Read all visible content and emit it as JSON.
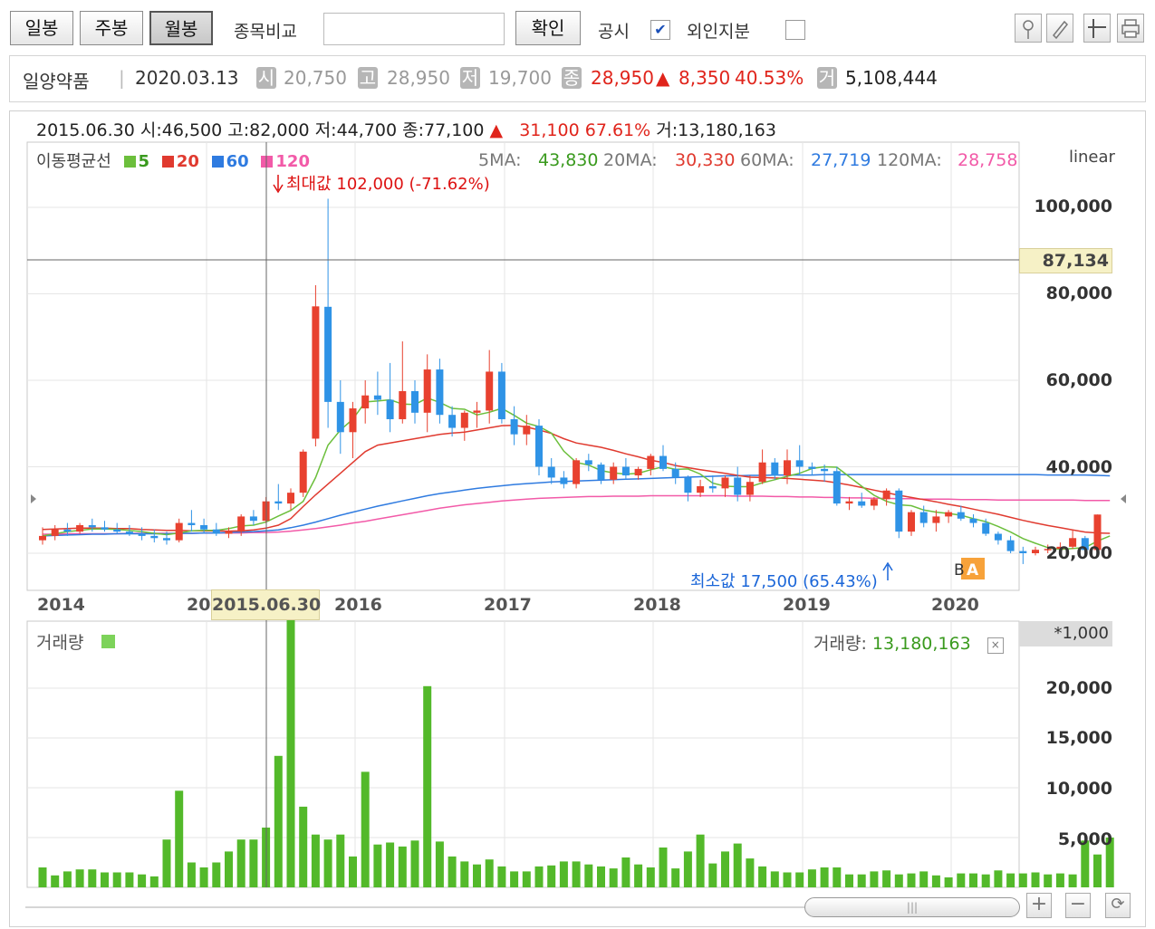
{
  "toolbar": {
    "tab_day": "일봉",
    "tab_week": "주봉",
    "tab_month": "월봉",
    "compare_label": "종목비교",
    "compare_value": "",
    "confirm": "확인",
    "disclosure_label": "공시",
    "disclosure_checked": "✔",
    "foreign_label": "외인지분"
  },
  "stock": {
    "name": "일양약품",
    "date": "2020.03.13",
    "open_badge": "시",
    "open": "20,750",
    "high_badge": "고",
    "high": "28,950",
    "low_badge": "저",
    "low": "19,700",
    "close_badge": "종",
    "close": "28,950",
    "change_arrow": "▲",
    "change": "8,350",
    "change_pct": "40.53%",
    "volume_badge": "거",
    "volume": "5,108,444"
  },
  "cursor": {
    "date": "2015.06.30",
    "open_label": "시:",
    "open": "46,500",
    "high_label": "고:",
    "high": "82,000",
    "low_label": "저:",
    "low": "44,700",
    "close_label": "종:",
    "close": "77,100",
    "arrow": "▲",
    "change": "31,100",
    "change_pct": "67.61%",
    "volume_label": "거:",
    "volume": "13,180,163",
    "price_marker": "87,134",
    "date_marker": "2015.06.30"
  },
  "ma": {
    "title": "이동평균선",
    "p5": "5",
    "p20": "20",
    "p60": "60",
    "p120": "120",
    "ma5_label": "5MA:",
    "ma5": "43,830",
    "ma20_label": "20MA:",
    "ma20": "30,330",
    "ma60_label": "60MA:",
    "ma60": "27,719",
    "ma120_label": "120MA:",
    "ma120": "28,758",
    "color5": "#6cbf3c",
    "color20": "#e03a2f",
    "color60": "#2f7be0",
    "color120": "#f25aa8"
  },
  "annotations": {
    "max_label": "최대값 102,000 (-71.62%)",
    "min_label": "최소값 17,500 (65.43%)",
    "scale": "linear",
    "marker_A": "A",
    "marker_B": "B"
  },
  "volume_panel": {
    "title": "거래량",
    "value_label": "거래량:",
    "value": "13,180,163",
    "unit": "*1,000"
  },
  "chart_data": {
    "type": "candlestick",
    "period": "monthly",
    "y_axis": {
      "min": 15000,
      "max": 110000,
      "ticks": [
        "100,000",
        "80,000",
        "60,000",
        "40,000",
        "20,000"
      ],
      "scale": "linear"
    },
    "x_axis": {
      "ticks": [
        "2014",
        "20",
        "2016",
        "2017",
        "2018",
        "2019",
        "2020"
      ]
    },
    "volume_axis": {
      "ticks": [
        "20,000",
        "15,000",
        "10,000",
        "5,000"
      ],
      "unit": "*1,000"
    },
    "candles": [
      {
        "o": 23000,
        "h": 26000,
        "l": 22000,
        "c": 24000
      },
      {
        "o": 24000,
        "h": 26500,
        "l": 23000,
        "c": 25500
      },
      {
        "o": 25500,
        "h": 27000,
        "l": 24000,
        "c": 25000
      },
      {
        "o": 25000,
        "h": 27000,
        "l": 24500,
        "c": 26500
      },
      {
        "o": 26500,
        "h": 28000,
        "l": 25000,
        "c": 26000
      },
      {
        "o": 26000,
        "h": 27500,
        "l": 25000,
        "c": 25500
      },
      {
        "o": 25500,
        "h": 27000,
        "l": 24500,
        "c": 25000
      },
      {
        "o": 25000,
        "h": 26500,
        "l": 24000,
        "c": 24500
      },
      {
        "o": 24500,
        "h": 26000,
        "l": 23000,
        "c": 24000
      },
      {
        "o": 24000,
        "h": 25500,
        "l": 22500,
        "c": 23500
      },
      {
        "o": 23500,
        "h": 25000,
        "l": 22000,
        "c": 23000
      },
      {
        "o": 23000,
        "h": 28000,
        "l": 22500,
        "c": 27000
      },
      {
        "o": 27000,
        "h": 30000,
        "l": 25000,
        "c": 26500
      },
      {
        "o": 26500,
        "h": 28000,
        "l": 24500,
        "c": 25500
      },
      {
        "o": 25500,
        "h": 27000,
        "l": 24000,
        "c": 24500
      },
      {
        "o": 24500,
        "h": 26000,
        "l": 23500,
        "c": 25000
      },
      {
        "o": 25000,
        "h": 29000,
        "l": 24000,
        "c": 28500
      },
      {
        "o": 28500,
        "h": 30000,
        "l": 26500,
        "c": 27500
      },
      {
        "o": 27500,
        "h": 33000,
        "l": 27000,
        "c": 32000
      },
      {
        "o": 32000,
        "h": 36000,
        "l": 30000,
        "c": 31500
      },
      {
        "o": 31500,
        "h": 35000,
        "l": 30000,
        "c": 34000
      },
      {
        "o": 34000,
        "h": 44000,
        "l": 33000,
        "c": 43500
      },
      {
        "o": 46500,
        "h": 82000,
        "l": 44700,
        "c": 77100
      },
      {
        "o": 77000,
        "h": 102000,
        "l": 49000,
        "c": 55000
      },
      {
        "o": 55000,
        "h": 60000,
        "l": 43000,
        "c": 48000
      },
      {
        "o": 48000,
        "h": 55000,
        "l": 42000,
        "c": 53500
      },
      {
        "o": 53500,
        "h": 60000,
        "l": 50000,
        "c": 56500
      },
      {
        "o": 56500,
        "h": 62000,
        "l": 52000,
        "c": 55500
      },
      {
        "o": 55500,
        "h": 64000,
        "l": 48000,
        "c": 51000
      },
      {
        "o": 51000,
        "h": 69000,
        "l": 50000,
        "c": 57500
      },
      {
        "o": 57500,
        "h": 60000,
        "l": 50000,
        "c": 52500
      },
      {
        "o": 52500,
        "h": 66000,
        "l": 48000,
        "c": 62500
      },
      {
        "o": 62500,
        "h": 65000,
        "l": 50000,
        "c": 52000
      },
      {
        "o": 52000,
        "h": 54000,
        "l": 47000,
        "c": 49000
      },
      {
        "o": 49000,
        "h": 53000,
        "l": 46000,
        "c": 52500
      },
      {
        "o": 52500,
        "h": 55000,
        "l": 49000,
        "c": 53000
      },
      {
        "o": 53000,
        "h": 67000,
        "l": 50000,
        "c": 62000
      },
      {
        "o": 62000,
        "h": 64000,
        "l": 50000,
        "c": 51000
      },
      {
        "o": 51000,
        "h": 54000,
        "l": 45000,
        "c": 47500
      },
      {
        "o": 47500,
        "h": 52000,
        "l": 45000,
        "c": 49500
      },
      {
        "o": 49500,
        "h": 51000,
        "l": 38000,
        "c": 40000
      },
      {
        "o": 40000,
        "h": 42000,
        "l": 36000,
        "c": 37500
      },
      {
        "o": 37500,
        "h": 39000,
        "l": 35000,
        "c": 36000
      },
      {
        "o": 36000,
        "h": 42000,
        "l": 35000,
        "c": 41500
      },
      {
        "o": 41500,
        "h": 43000,
        "l": 39000,
        "c": 40500
      },
      {
        "o": 40500,
        "h": 41000,
        "l": 36000,
        "c": 37000
      },
      {
        "o": 37000,
        "h": 41000,
        "l": 36000,
        "c": 40000
      },
      {
        "o": 40000,
        "h": 42000,
        "l": 37000,
        "c": 38000
      },
      {
        "o": 38000,
        "h": 40000,
        "l": 37000,
        "c": 39500
      },
      {
        "o": 39500,
        "h": 43000,
        "l": 38000,
        "c": 42500
      },
      {
        "o": 42500,
        "h": 45000,
        "l": 39000,
        "c": 39500
      },
      {
        "o": 39500,
        "h": 41000,
        "l": 36000,
        "c": 37500
      },
      {
        "o": 37500,
        "h": 38000,
        "l": 32000,
        "c": 34000
      },
      {
        "o": 34000,
        "h": 37000,
        "l": 33000,
        "c": 35500
      },
      {
        "o": 35500,
        "h": 38000,
        "l": 34000,
        "c": 35000
      },
      {
        "o": 35000,
        "h": 38000,
        "l": 33000,
        "c": 37500
      },
      {
        "o": 37500,
        "h": 40000,
        "l": 32000,
        "c": 33500
      },
      {
        "o": 33500,
        "h": 38000,
        "l": 32000,
        "c": 36500
      },
      {
        "o": 36500,
        "h": 44000,
        "l": 36000,
        "c": 41000
      },
      {
        "o": 41000,
        "h": 42000,
        "l": 37000,
        "c": 38000
      },
      {
        "o": 38000,
        "h": 44000,
        "l": 36000,
        "c": 41500
      },
      {
        "o": 41500,
        "h": 45000,
        "l": 38000,
        "c": 40000
      },
      {
        "o": 40000,
        "h": 41000,
        "l": 38000,
        "c": 39500
      },
      {
        "o": 39500,
        "h": 40500,
        "l": 36500,
        "c": 39000
      },
      {
        "o": 39000,
        "h": 40000,
        "l": 31000,
        "c": 31500
      },
      {
        "o": 31500,
        "h": 33000,
        "l": 30000,
        "c": 32000
      },
      {
        "o": 32000,
        "h": 34000,
        "l": 30500,
        "c": 31000
      },
      {
        "o": 31000,
        "h": 33000,
        "l": 30000,
        "c": 32500
      },
      {
        "o": 32500,
        "h": 35000,
        "l": 31000,
        "c": 34500
      },
      {
        "o": 34500,
        "h": 35000,
        "l": 23500,
        "c": 25000
      },
      {
        "o": 25000,
        "h": 30000,
        "l": 24000,
        "c": 29500
      },
      {
        "o": 29500,
        "h": 31000,
        "l": 26000,
        "c": 27000
      },
      {
        "o": 27000,
        "h": 30000,
        "l": 25000,
        "c": 28500
      },
      {
        "o": 28500,
        "h": 30000,
        "l": 27000,
        "c": 29500
      },
      {
        "o": 29500,
        "h": 31000,
        "l": 27500,
        "c": 28000
      },
      {
        "o": 28000,
        "h": 29000,
        "l": 26000,
        "c": 27000
      },
      {
        "o": 27000,
        "h": 28000,
        "l": 24000,
        "c": 24500
      },
      {
        "o": 24500,
        "h": 25000,
        "l": 22000,
        "c": 23000
      },
      {
        "o": 23000,
        "h": 24000,
        "l": 20000,
        "c": 20500
      },
      {
        "o": 20500,
        "h": 21500,
        "l": 17500,
        "c": 20000
      },
      {
        "o": 20000,
        "h": 21500,
        "l": 19500,
        "c": 20800
      },
      {
        "o": 20800,
        "h": 22000,
        "l": 20000,
        "c": 21000
      },
      {
        "o": 21000,
        "h": 22500,
        "l": 20000,
        "c": 21500
      },
      {
        "o": 21500,
        "h": 25500,
        "l": 21000,
        "c": 23500
      },
      {
        "o": 23500,
        "h": 24000,
        "l": 20000,
        "c": 20750
      },
      {
        "o": 20750,
        "h": 28950,
        "l": 19700,
        "c": 28950
      }
    ],
    "volume": [
      2000,
      1200,
      1600,
      1800,
      1800,
      1500,
      1500,
      1500,
      1300,
      1100,
      4800,
      9700,
      2500,
      2000,
      2500,
      3600,
      4800,
      4800,
      6000,
      13200,
      28000,
      8100,
      5300,
      4800,
      5300,
      3100,
      11600,
      4300,
      4500,
      4100,
      4700,
      20200,
      4600,
      3100,
      2600,
      2300,
      2800,
      2100,
      1600,
      1600,
      2100,
      2200,
      2600,
      2600,
      2300,
      2100,
      1900,
      3000,
      2300,
      2000,
      4000,
      1900,
      3600,
      5300,
      2400,
      3600,
      4400,
      2900,
      2100,
      1600,
      1500,
      1500,
      1800,
      2000,
      2000,
      1300,
      1300,
      1600,
      1700,
      1300,
      1400,
      1600,
      1200,
      1000,
      1400,
      1400,
      1300,
      1700,
      1400,
      1400,
      1500,
      1300,
      1400,
      1300,
      4700,
      3300,
      5000
    ],
    "ma_series": {
      "ma5": [
        24000,
        24500,
        25000,
        25300,
        25600,
        25600,
        25500,
        25300,
        25000,
        24600,
        24300,
        24700,
        25200,
        25300,
        25300,
        25700,
        26300,
        26500,
        27200,
        28600,
        29900,
        32000,
        37500,
        45000,
        48500,
        51000,
        55000,
        55200,
        55500,
        54500,
        54400,
        55900,
        54900,
        53500,
        53300,
        52000,
        52600,
        53500,
        51900,
        50100,
        49300,
        47800,
        43600,
        41000,
        40400,
        39100,
        38600,
        38300,
        38500,
        39300,
        40000,
        39400,
        39500,
        38300,
        36200,
        35500,
        35400,
        35400,
        36300,
        37000,
        37800,
        38500,
        39600,
        40000,
        39900,
        37700,
        35500,
        33400,
        32000,
        31200,
        31000,
        30000,
        29500,
        29200,
        28800,
        28000,
        27300,
        26200,
        24900,
        23400,
        22300,
        21300,
        20900,
        21100,
        21300,
        22800,
        24000
      ],
      "ma20": [
        25500,
        25600,
        25700,
        25800,
        25800,
        25800,
        25700,
        25700,
        25500,
        25400,
        25300,
        25300,
        25200,
        25200,
        25200,
        25100,
        25200,
        25400,
        25800,
        26500,
        28000,
        30800,
        33500,
        36000,
        38500,
        41000,
        43500,
        45000,
        45500,
        46000,
        46500,
        47000,
        47500,
        47800,
        48000,
        48500,
        49000,
        49500,
        49600,
        49200,
        48500,
        47700,
        46500,
        45500,
        45000,
        44500,
        43800,
        43000,
        42300,
        41500,
        41000,
        40300,
        39800,
        39300,
        38900,
        38500,
        38000,
        37600,
        37500,
        37400,
        37300,
        37100,
        36900,
        36700,
        36300,
        35800,
        35200,
        34600,
        34000,
        33400,
        32900,
        32400,
        31900,
        31300,
        30800,
        30200,
        29600,
        29000,
        28300,
        27600,
        27000,
        26400,
        25900,
        25400,
        24900,
        24700,
        24600
      ],
      "ma60": [
        24000,
        24100,
        24200,
        24300,
        24400,
        24400,
        24500,
        24500,
        24500,
        24500,
        24500,
        24600,
        24600,
        24700,
        24700,
        24800,
        24900,
        25000,
        25200,
        25400,
        25900,
        26500,
        27200,
        28000,
        28800,
        29500,
        30200,
        30900,
        31500,
        32100,
        32700,
        33300,
        33800,
        34200,
        34600,
        35000,
        35300,
        35600,
        35900,
        36100,
        36300,
        36500,
        36600,
        36700,
        36800,
        36900,
        37000,
        37100,
        37200,
        37300,
        37400,
        37500,
        37600,
        37700,
        37800,
        37900,
        37900,
        38000,
        38000,
        38100,
        38100,
        38100,
        38100,
        38200,
        38200,
        38200,
        38200,
        38200,
        38200,
        38200,
        38200,
        38200,
        38200,
        38200,
        38200,
        38200,
        38200,
        38200,
        38200,
        38200,
        38200,
        38100,
        38100,
        38100,
        38100,
        38000,
        37900
      ],
      "ma120": [
        24400,
        24400,
        24500,
        24500,
        24500,
        24500,
        24500,
        24600,
        24600,
        24600,
        24600,
        24600,
        24600,
        24700,
        24700,
        24700,
        24700,
        24800,
        24800,
        24900,
        25100,
        25400,
        25700,
        26100,
        26500,
        27000,
        27400,
        27900,
        28400,
        28900,
        29400,
        29900,
        30400,
        30800,
        31200,
        31500,
        31800,
        32100,
        32300,
        32500,
        32700,
        32800,
        32900,
        33000,
        33100,
        33100,
        33200,
        33200,
        33200,
        33300,
        33300,
        33300,
        33300,
        33300,
        33300,
        33300,
        33200,
        33200,
        33200,
        33100,
        33100,
        33000,
        33000,
        32900,
        32900,
        32800,
        32800,
        32700,
        32700,
        32600,
        32600,
        32500,
        32500,
        32500,
        32400,
        32400,
        32400,
        32300,
        32300,
        32300,
        32300,
        32300,
        32300,
        32300,
        32200,
        32200,
        32200
      ]
    }
  },
  "controls": {
    "zoom_in": "+",
    "zoom_out": "−",
    "reset": "⟳",
    "scroll_grip": "|||",
    "tool_icons": [
      "crosshair-icon",
      "pencil-icon",
      "cursor-icon",
      "print-icon"
    ]
  }
}
